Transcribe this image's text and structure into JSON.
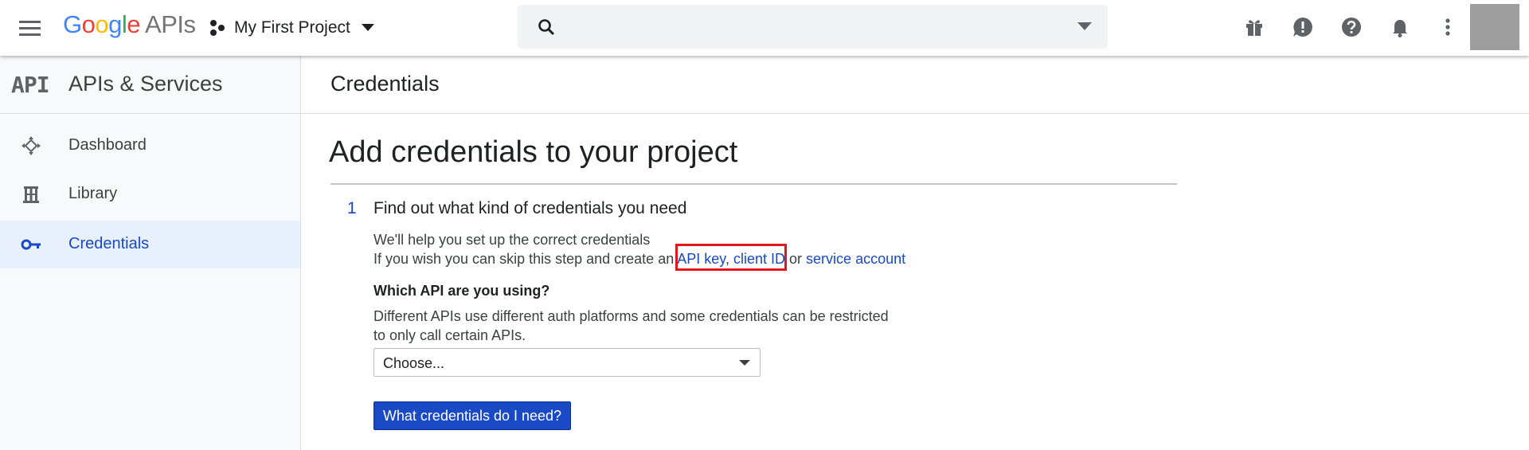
{
  "header": {
    "logo": {
      "letters": [
        "G",
        "o",
        "o",
        "g",
        "l",
        "e"
      ],
      "suffix": "APIs"
    },
    "project": {
      "name": "My First Project"
    },
    "search": {
      "value": "",
      "placeholder": ""
    },
    "icons": [
      "menu-icon",
      "project-dots-icon",
      "search-icon",
      "gift-icon",
      "feedback-icon",
      "help-icon",
      "notifications-icon",
      "more-vert-icon"
    ]
  },
  "sidebar": {
    "logo_text": "API",
    "title": "APIs & Services",
    "items": [
      {
        "label": "Dashboard",
        "icon": "dashboard-icon",
        "active": false
      },
      {
        "label": "Library",
        "icon": "library-icon",
        "active": false
      },
      {
        "label": "Credentials",
        "icon": "key-icon",
        "active": true
      }
    ]
  },
  "main": {
    "page_title": "Credentials",
    "heading": "Add credentials to your project",
    "step": {
      "number": "1",
      "title": "Find out what kind of credentials you need",
      "intro": "We'll help you set up the correct credentials",
      "skip_prefix": "If you wish you can skip this step and create an",
      "api_key_link": "API key",
      "comma": ",",
      "client_id_link": "client ID",
      "or_text": "or",
      "service_account_link": "service account",
      "api_question": "Which API are you using?",
      "api_desc_line1": "Different APIs use different auth platforms and some credentials can be restricted",
      "api_desc_line2": "to only call certain APIs.",
      "select_value": "Choose...",
      "button_label": "What credentials do I need?"
    }
  },
  "colors": {
    "accent": "#1a49c6",
    "highlight_box": "#e5161b",
    "sidebar_active_bg": "#e8f0fe",
    "avatar": "#9e9e9e"
  }
}
